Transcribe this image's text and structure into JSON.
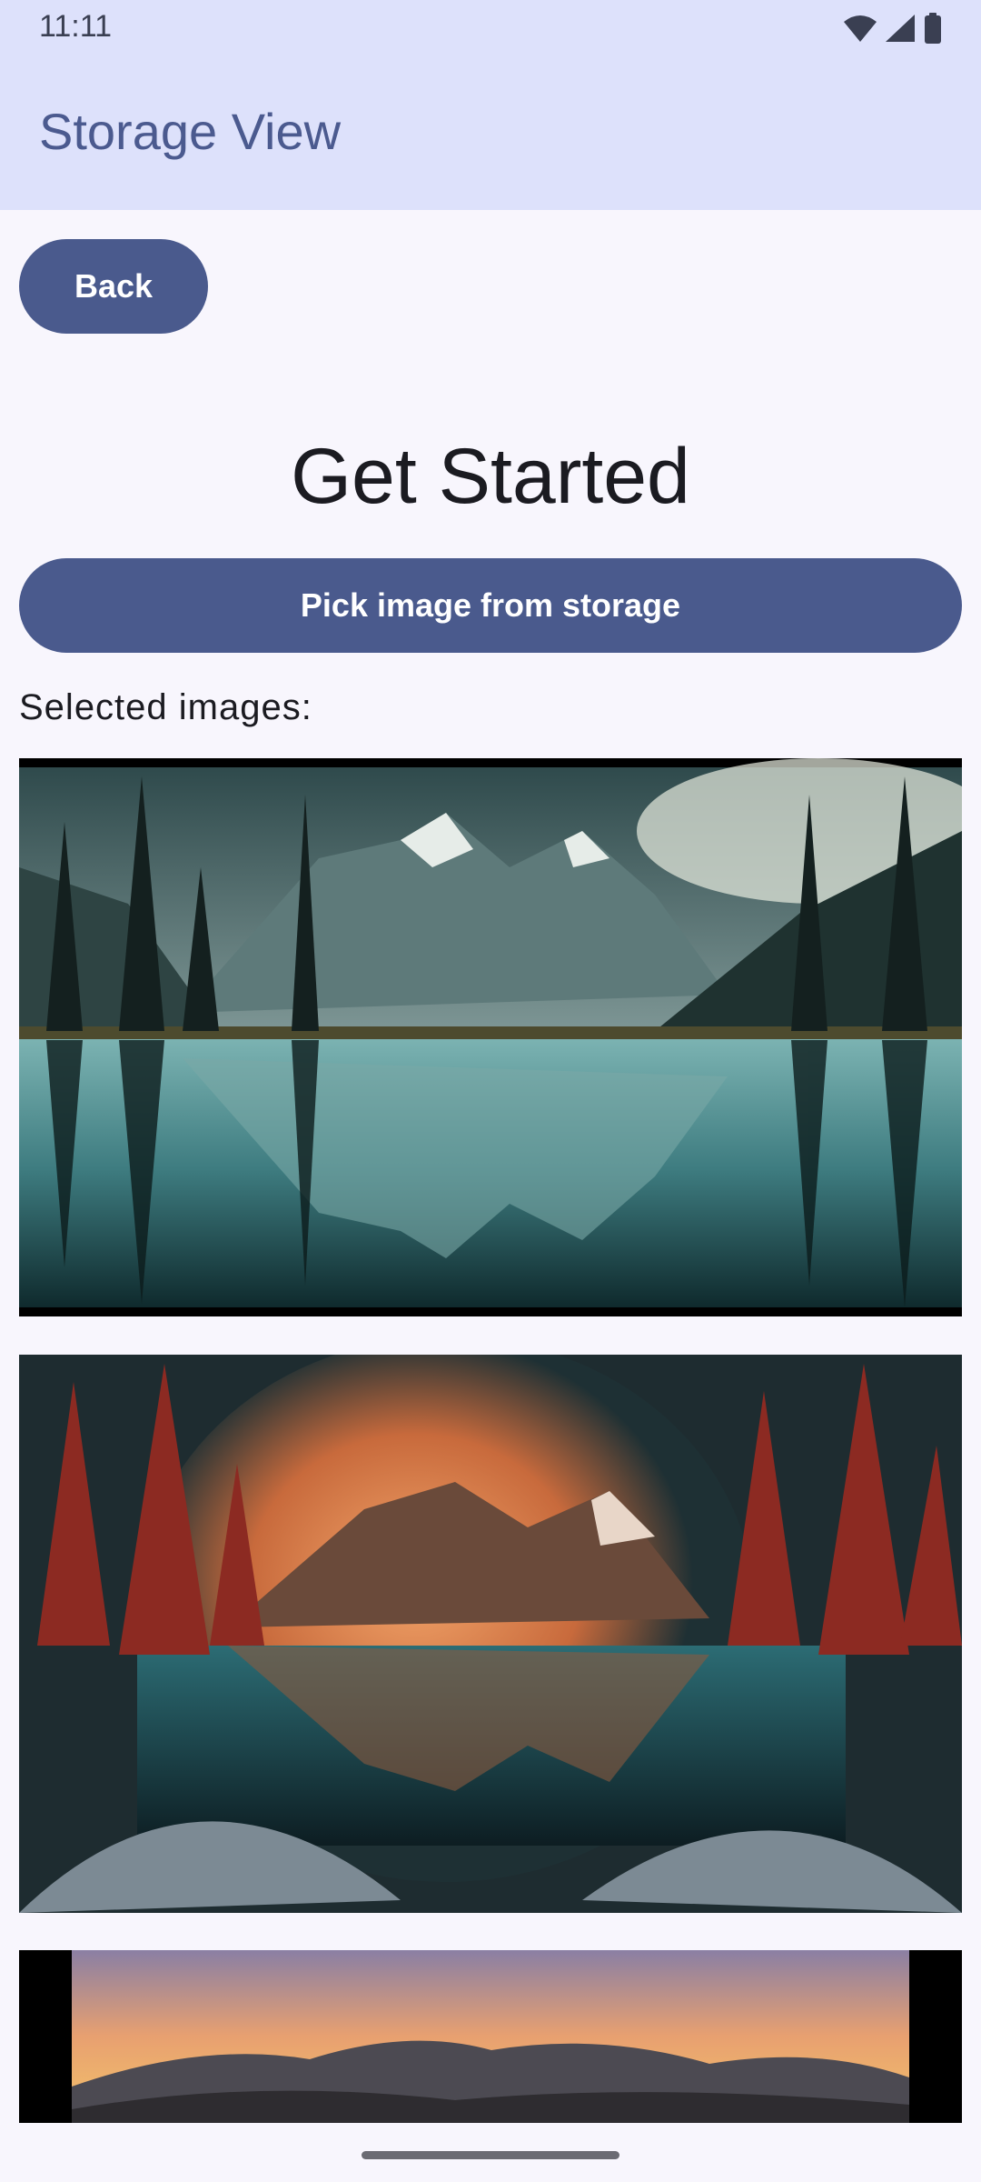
{
  "status_bar": {
    "time": "11:11",
    "icons": [
      "wifi-icon",
      "cellular-signal-icon",
      "battery-icon"
    ]
  },
  "app_bar": {
    "title": "Storage View"
  },
  "content": {
    "back_label": "Back",
    "headline": "Get Started",
    "pick_label": "Pick image from storage",
    "selected_label": "Selected images:",
    "images": [
      {
        "name": "mountain-lake-reflection-image"
      },
      {
        "name": "red-trees-mountain-lake-image"
      },
      {
        "name": "sunset-hills-image"
      }
    ]
  },
  "colors": {
    "app_bar_bg": "#dde1fb",
    "primary_button": "#4a5a8d",
    "title_color": "#4b5a8f",
    "background": "#f8f6fd"
  }
}
